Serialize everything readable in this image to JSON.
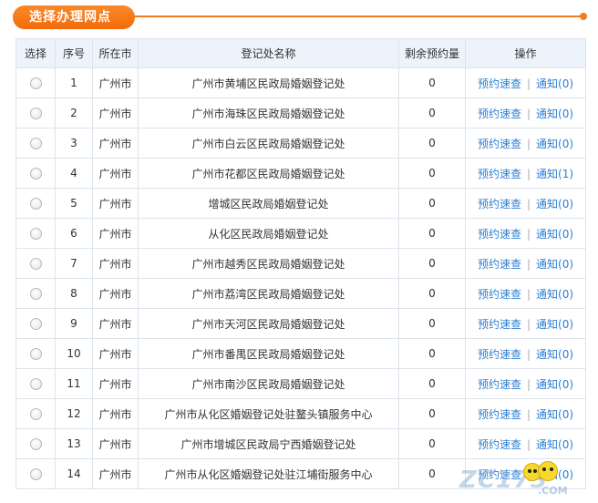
{
  "header": {
    "title": "选择办理网点"
  },
  "columns": [
    "选择",
    "序号",
    "所在市",
    "登记处名称",
    "剩余预约量",
    "操作"
  ],
  "rows": [
    {
      "no": "1",
      "city": "广州市",
      "name": "广州市黄埔区民政局婚姻登记处",
      "remaining": "0",
      "quick": "预约速查",
      "notice": "通知(0)"
    },
    {
      "no": "2",
      "city": "广州市",
      "name": "广州市海珠区民政局婚姻登记处",
      "remaining": "0",
      "quick": "预约速查",
      "notice": "通知(0)"
    },
    {
      "no": "3",
      "city": "广州市",
      "name": "广州市白云区民政局婚姻登记处",
      "remaining": "0",
      "quick": "预约速查",
      "notice": "通知(0)"
    },
    {
      "no": "4",
      "city": "广州市",
      "name": "广州市花都区民政局婚姻登记处",
      "remaining": "0",
      "quick": "预约速查",
      "notice": "通知(1)"
    },
    {
      "no": "5",
      "city": "广州市",
      "name": "增城区民政局婚姻登记处",
      "remaining": "0",
      "quick": "预约速查",
      "notice": "通知(0)"
    },
    {
      "no": "6",
      "city": "广州市",
      "name": "从化区民政局婚姻登记处",
      "remaining": "0",
      "quick": "预约速查",
      "notice": "通知(0)"
    },
    {
      "no": "7",
      "city": "广州市",
      "name": "广州市越秀区民政局婚姻登记处",
      "remaining": "0",
      "quick": "预约速查",
      "notice": "通知(0)"
    },
    {
      "no": "8",
      "city": "广州市",
      "name": "广州市荔湾区民政局婚姻登记处",
      "remaining": "0",
      "quick": "预约速查",
      "notice": "通知(0)"
    },
    {
      "no": "9",
      "city": "广州市",
      "name": "广州市天河区民政局婚姻登记处",
      "remaining": "0",
      "quick": "预约速查",
      "notice": "通知(0)"
    },
    {
      "no": "10",
      "city": "广州市",
      "name": "广州市番禺区民政局婚姻登记处",
      "remaining": "0",
      "quick": "预约速查",
      "notice": "通知(0)"
    },
    {
      "no": "11",
      "city": "广州市",
      "name": "广州市南沙区民政局婚姻登记处",
      "remaining": "0",
      "quick": "预约速查",
      "notice": "通知(0)"
    },
    {
      "no": "12",
      "city": "广州市",
      "name": "广州市从化区婚姻登记处驻鳌头镇服务中心",
      "remaining": "0",
      "quick": "预约速查",
      "notice": "通知(0)"
    },
    {
      "no": "13",
      "city": "广州市",
      "name": "广州市增城区民政局宁西婚姻登记处",
      "remaining": "0",
      "quick": "预约速查",
      "notice": "通知(0)"
    },
    {
      "no": "14",
      "city": "广州市",
      "name": "广州市从化区婚姻登记处驻江埔街服务中心",
      "remaining": "0",
      "quick": "预约速查",
      "notice": "通知(0)"
    }
  ],
  "separator": "|",
  "watermark": {
    "text": "ZC173",
    "sub": ".COM"
  },
  "colors": {
    "accent": "#f37b1d",
    "link": "#2d7fd3",
    "remaining": "#e02020",
    "header_bg": "#edf3fa",
    "border": "#dce4ec"
  }
}
